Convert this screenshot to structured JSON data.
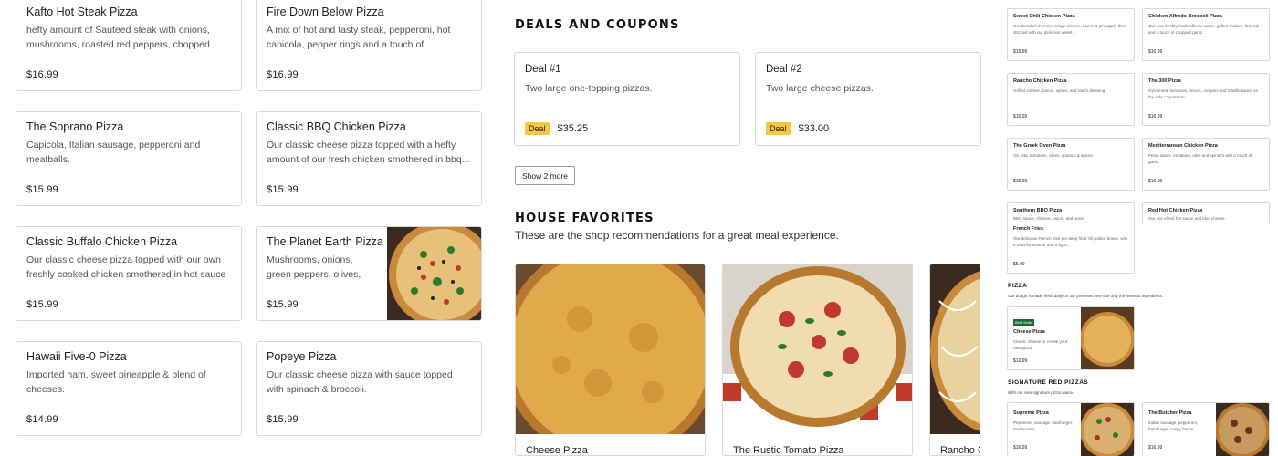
{
  "menu_items": [
    {
      "name": "Kafto Hot Steak Pizza",
      "desc": "hefty amount of Sauteed steak with onions, mushrooms, roasted red peppers, chopped garlic...",
      "price": "$16.99"
    },
    {
      "name": "Fire Down Below Pizza",
      "desc": "A mix of hot and tasty steak, pepperoni, hot capicola, pepper rings and a touch of chopped...",
      "price": "$16.99"
    },
    {
      "name": "The Soprano Pizza",
      "desc": "Capicola, Italian sausage, pepperoni and meatballs.",
      "price": "$15.99"
    },
    {
      "name": "Classic BBQ Chicken Pizza",
      "desc": "Our classic cheese pizza topped with a hefty amount of our fresh chicken smothered in bbq...",
      "price": "$15.99"
    },
    {
      "name": "Classic Buffalo Chicken Pizza",
      "desc": "Our classic cheese pizza topped with our own freshly cooked chicken smothered in hot sauce",
      "price": "$15.99"
    },
    {
      "name": "The Planet Earth Pizza",
      "desc": "Mushrooms, onions, green peppers, olives, roasted...",
      "price": "$15.99"
    },
    {
      "name": "Hawaii Five-0 Pizza",
      "desc": "Imported ham, sweet pineapple & blend of cheeses.",
      "price": "$14.99"
    },
    {
      "name": "Popeye Pizza",
      "desc": "Our classic cheese pizza with sauce topped with spinach & broccoli.",
      "price": "$15.99"
    }
  ],
  "deals": {
    "heading": "DEALS AND COUPONS",
    "items": [
      {
        "title": "Deal #1",
        "desc": "Two large one-topping pizzas.",
        "badge": "Deal",
        "price": "$35.25"
      },
      {
        "title": "Deal #2",
        "desc": "Two large cheese pizzas.",
        "badge": "Deal",
        "price": "$33.00"
      }
    ],
    "more_label": "Show 2 more"
  },
  "house": {
    "heading": "HOUSE FAVORITES",
    "sub": "These are the shop recommendations for a great meal experience.",
    "items": [
      {
        "name": "Cheese Pizza"
      },
      {
        "name": "The Rustic Tomato Pizza"
      },
      {
        "name": "Rancho C"
      }
    ]
  },
  "mini": {
    "cards": [
      {
        "name": "Sweet Chili Chicken Pizza",
        "desc": "Our blend of cheeses, crispy chicken, bacon & pineapple then drizzled with our delicious sweet...",
        "price": "$15.99"
      },
      {
        "name": "Chicken Alfredo Broccoli Pizza",
        "desc": "Our own freshly made alfredo sauce, grilled chicken, broccoli and a touch of chopped garlic.",
        "price": "$16.99"
      },
      {
        "name": "Rancho Chicken Pizza",
        "desc": "Grilled chicken, bacon, spices, and ranch dressing.",
        "price": "$16.99"
      },
      {
        "name": "The 300 Pizza",
        "desc": "Gyro meat, tomatoes, onions, oregano and tzatziki sauce on the side \" Spartans\".",
        "price": "$16.99"
      },
      {
        "name": "The Greek Oven Pizza",
        "desc": "Oil, feta, tomatoes, olives, spinach & spices.",
        "price": "$15.99"
      },
      {
        "name": "Mediterranean Chicken Pizza",
        "desc": "Pesto sauce, tomatoes, olive and spinach with a touch of garlic.",
        "price": "$16.99"
      },
      {
        "name": "Southern BBQ Pizza",
        "desc": "BBQ sauce, chicken, bacon, and onion.",
        "price": ""
      },
      {
        "name": "Red Hot Chicken Pizza",
        "desc": "Our mix of red hot sauce and blue cheese.",
        "price": ""
      },
      {
        "name": "French Fries",
        "desc": "Our delicious French fries are deep fried 'till golden brown, with a crunchy exterior and a light...",
        "price": "$5.00"
      }
    ],
    "pizza_heading": "PIZZA",
    "pizza_sub": "Our dough is made fresh daily on our premises. We use only the freshest ingredients.",
    "cheese": {
      "badge": "Best Seller",
      "name": "Cheese Pizza",
      "desc": "Classic cheese or create your own pizza.",
      "price": "$12.99"
    },
    "sig_heading": "SIGNATURE RED PIZZAS",
    "sig_sub": "With our own signature pizza sauce.",
    "sig": [
      {
        "name": "Supreme Pizza",
        "desc": "Pepperoni, sausage, hamburger, mushrooms,...",
        "price": "$16.99"
      },
      {
        "name": "The Butcher Pizza",
        "desc": "Italian sausage, pepperoni, hamburger, crispy bacon,...",
        "price": "$16.99"
      }
    ]
  }
}
